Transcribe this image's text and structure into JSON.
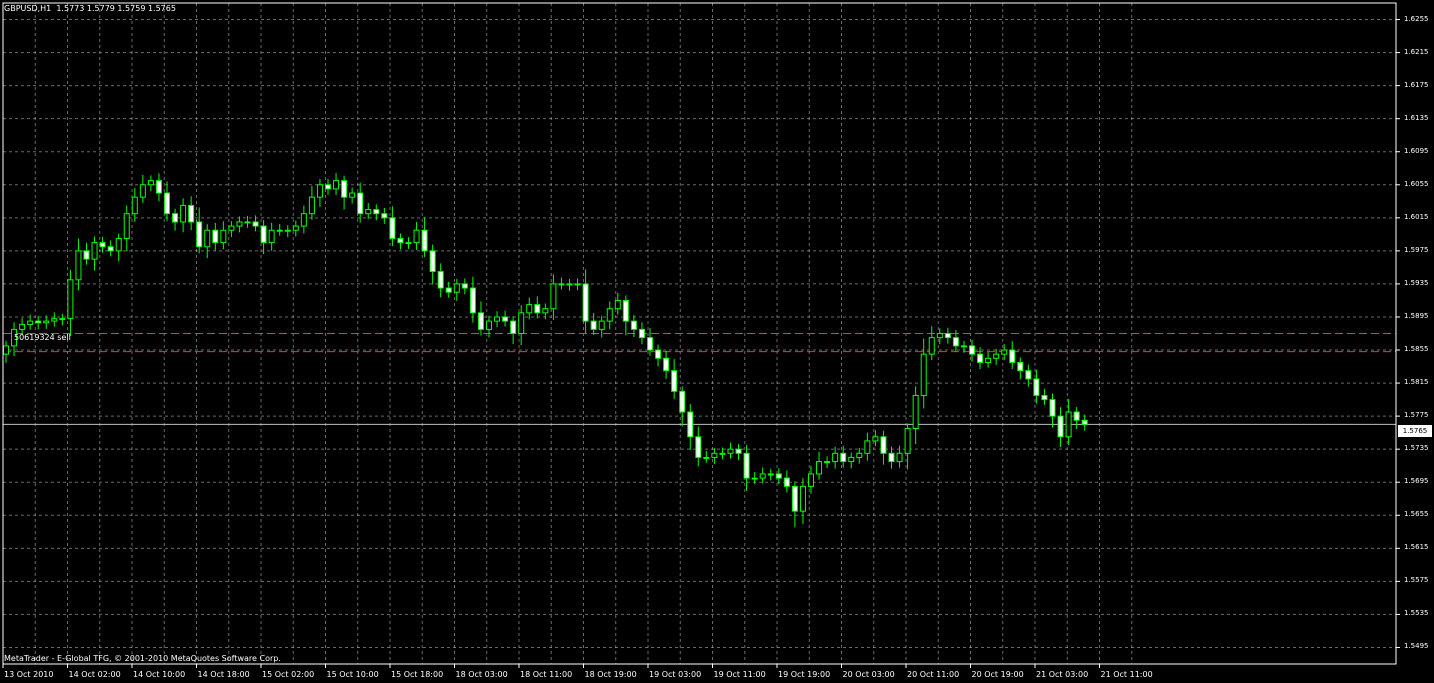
{
  "header": {
    "title": "GBPUSD,H1  1.5773 1.5779 1.5759 1.5765"
  },
  "footer": {
    "copyright": "MetaTrader - E-Global TFG, © 2001-2010 MetaQuotes Software Corp."
  },
  "order_line": {
    "label": "50619324 sell",
    "price": 1.5875,
    "color": "#00b050"
  },
  "stop_line": {
    "price": 1.5853,
    "color": "#ff3030"
  },
  "current_price": {
    "label": "1.5765",
    "value": 1.5765
  },
  "colors": {
    "bull": "#00ff00",
    "bear_body": "#ffffff",
    "grid": "#c0c0c0",
    "axis": "#ffffff"
  },
  "chart_data": {
    "type": "candlestick",
    "symbol": "GBPUSD",
    "timeframe": "H1",
    "ylim": [
      1.5475,
      1.6275
    ],
    "price_ticks": [
      "1.6255",
      "1.6215",
      "1.6175",
      "1.6135",
      "1.6095",
      "1.6055",
      "1.6015",
      "1.5975",
      "1.5935",
      "1.5895",
      "1.5855",
      "1.5815",
      "1.5775",
      "1.5735",
      "1.5695",
      "1.5655",
      "1.5615",
      "1.5575",
      "1.5535",
      "1.5495"
    ],
    "time_ticks": [
      "13 Oct 2010",
      "14 Oct 02:00",
      "14 Oct 10:00",
      "14 Oct 18:00",
      "15 Oct 02:00",
      "15 Oct 10:00",
      "15 Oct 18:00",
      "18 Oct 03:00",
      "18 Oct 11:00",
      "18 Oct 19:00",
      "19 Oct 03:00",
      "19 Oct 11:00",
      "19 Oct 19:00",
      "20 Oct 03:00",
      "20 Oct 11:00",
      "20 Oct 19:00",
      "21 Oct 03:00",
      "21 Oct 11:00"
    ],
    "closes": [
      1.586,
      1.588,
      1.5886,
      1.589,
      1.5888,
      1.589,
      1.5893,
      1.5893,
      1.594,
      1.5975,
      1.5965,
      1.5985,
      1.598,
      1.5975,
      1.599,
      1.602,
      1.604,
      1.6055,
      1.606,
      1.6045,
      1.602,
      1.601,
      1.603,
      1.601,
      1.598,
      1.6,
      1.5985,
      1.6,
      1.6005,
      1.601,
      1.601,
      1.6005,
      1.5985,
      1.6,
      1.6,
      1.6,
      1.6005,
      1.602,
      1.604,
      1.6055,
      1.605,
      1.606,
      1.604,
      1.6045,
      1.602,
      1.6025,
      1.602,
      1.6015,
      1.599,
      1.5985,
      1.5985,
      1.6,
      1.5975,
      1.595,
      1.593,
      1.5925,
      1.5935,
      1.593,
      1.59,
      1.588,
      1.589,
      1.5895,
      1.589,
      1.5875,
      1.59,
      1.591,
      1.59,
      1.5905,
      1.5935,
      1.5935,
      1.5935,
      1.5935,
      1.589,
      1.588,
      1.589,
      1.5905,
      1.5915,
      1.589,
      1.588,
      1.587,
      1.5855,
      1.5845,
      1.583,
      1.5805,
      1.578,
      1.575,
      1.5725,
      1.5725,
      1.573,
      1.573,
      1.5735,
      1.573,
      1.57,
      1.57,
      1.5705,
      1.5705,
      1.57,
      1.569,
      1.566,
      1.569,
      1.5705,
      1.572,
      1.572,
      1.573,
      1.572,
      1.5725,
      1.573,
      1.5745,
      1.575,
      1.573,
      1.572,
      1.573,
      1.576,
      1.58,
      1.585,
      1.587,
      1.5875,
      1.587,
      1.586,
      1.586,
      1.585,
      1.584,
      1.5845,
      1.585,
      1.5855,
      1.584,
      1.583,
      1.582,
      1.58,
      1.5795,
      1.5775,
      1.575,
      1.578,
      1.577,
      1.5765
    ]
  }
}
